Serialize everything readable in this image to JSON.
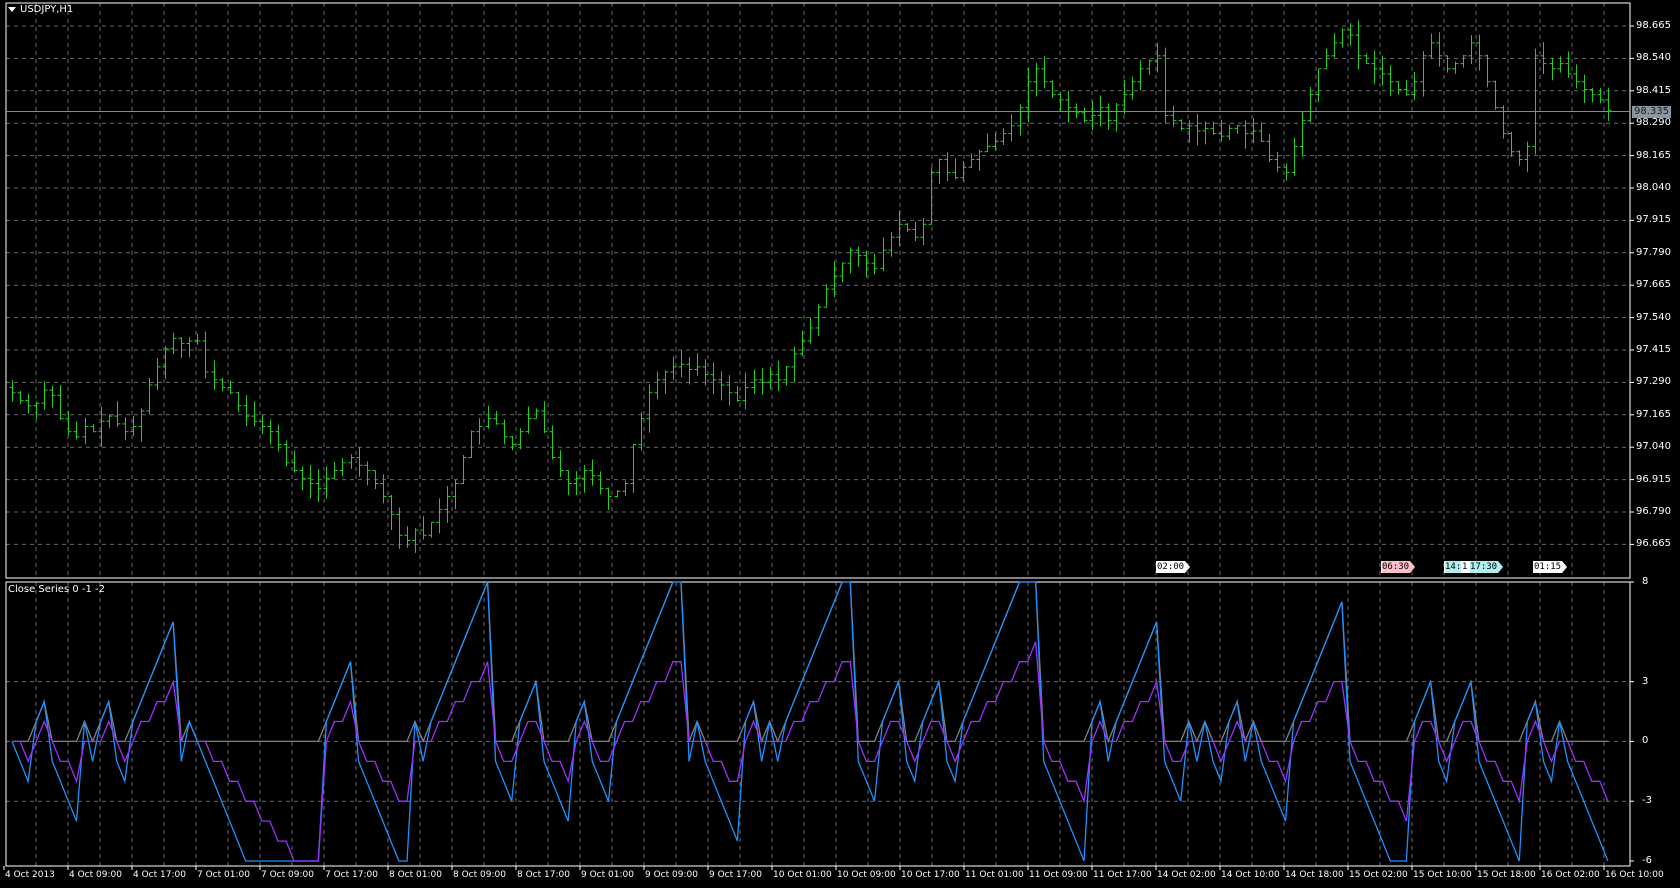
{
  "main": {
    "title": "USDJPY,H1",
    "current_price": "98.335",
    "price_ticks": [
      "98.665",
      "98.540",
      "98.415",
      "98.290",
      "98.165",
      "98.040",
      "97.915",
      "97.790",
      "97.665",
      "97.540",
      "97.415",
      "97.290",
      "97.165",
      "97.040",
      "96.915",
      "96.790",
      "96.665"
    ],
    "markers": [
      {
        "label": "02:00",
        "color": "#ffffff"
      },
      {
        "label": "06:30",
        "color": "#ffc0cb"
      },
      {
        "label": "14:",
        "color": "#b0f0f0"
      },
      {
        "label": "1",
        "color": "#ffffff"
      },
      {
        "label": "17:30",
        "color": "#b0f0f0"
      },
      {
        "label": "01:15",
        "color": "#ffffff"
      }
    ],
    "bar_color": "#22cc22"
  },
  "indicator": {
    "title": "Close Series 0 -1 -2",
    "ticks": [
      "8",
      "3",
      "0",
      "-3",
      "-6"
    ],
    "colors": [
      "#808080",
      "#1e90ff",
      "#9b30ff"
    ]
  },
  "time_axis": [
    "4 Oct 2013",
    "4 Oct 09:00",
    "4 Oct 17:00",
    "7 Oct 01:00",
    "7 Oct 09:00",
    "7 Oct 17:00",
    "8 Oct 01:00",
    "8 Oct 09:00",
    "8 Oct 17:00",
    "9 Oct 01:00",
    "9 Oct 09:00",
    "9 Oct 17:00",
    "10 Oct 01:00",
    "10 Oct 09:00",
    "10 Oct 17:00",
    "11 Oct 01:00",
    "11 Oct 09:00",
    "11 Oct 17:00",
    "14 Oct 02:00",
    "14 Oct 10:00",
    "14 Oct 18:00",
    "15 Oct 02:00",
    "15 Oct 10:00",
    "15 Oct 18:00",
    "16 Oct 02:00",
    "16 Oct 10:00"
  ],
  "chart_data": {
    "type": "line",
    "title": "USDJPY,H1",
    "ylim": [
      96.6,
      98.72
    ],
    "indicator_ylim": [
      -6,
      8
    ],
    "closes": [
      97.25,
      97.22,
      97.2,
      97.21,
      97.26,
      97.24,
      97.15,
      97.1,
      97.08,
      97.12,
      97.1,
      97.14,
      97.16,
      97.13,
      97.1,
      97.12,
      97.18,
      97.28,
      97.35,
      97.42,
      97.46,
      97.44,
      97.45,
      97.45,
      97.33,
      97.3,
      97.27,
      97.25,
      97.2,
      97.16,
      97.14,
      97.12,
      97.1,
      97.05,
      96.98,
      96.95,
      96.92,
      96.9,
      96.88,
      96.92,
      96.95,
      96.98,
      97.0,
      96.97,
      96.95,
      96.9,
      96.85,
      96.78,
      96.7,
      96.68,
      96.72,
      96.7,
      96.75,
      96.8,
      96.85,
      96.9,
      97.0,
      97.1,
      97.12,
      97.15,
      97.13,
      97.08,
      97.05,
      97.1,
      97.15,
      97.18,
      97.1,
      97.0,
      96.95,
      96.9,
      96.92,
      96.95,
      96.93,
      96.88,
      96.85,
      96.87,
      96.9,
      97.05,
      97.15,
      97.25,
      97.3,
      97.33,
      97.35,
      97.36,
      97.34,
      97.35,
      97.32,
      97.3,
      97.28,
      97.25,
      97.22,
      97.27,
      97.3,
      97.29,
      97.32,
      97.3,
      97.35,
      97.4,
      97.45,
      97.5,
      97.58,
      97.65,
      97.7,
      97.75,
      97.8,
      97.78,
      97.75,
      97.73,
      97.8,
      97.85,
      97.9,
      97.88,
      97.85,
      97.9,
      98.1,
      98.15,
      98.1,
      98.08,
      98.12,
      98.15,
      98.18,
      98.2,
      98.22,
      98.25,
      98.28,
      98.35,
      98.45,
      98.5,
      98.45,
      98.4,
      98.38,
      98.35,
      98.33,
      98.3,
      98.32,
      98.35,
      98.3,
      98.36,
      98.4,
      98.45,
      98.5,
      98.53,
      98.55,
      98.32,
      98.3,
      98.27,
      98.28,
      98.26,
      98.27,
      98.25,
      98.24,
      98.27,
      98.28,
      98.25,
      98.26,
      98.22,
      98.15,
      98.12,
      98.1,
      98.2,
      98.3,
      98.4,
      98.5,
      98.55,
      98.6,
      98.65,
      98.63,
      98.55,
      98.52,
      98.5,
      98.48,
      98.45,
      98.42,
      98.4,
      98.45,
      98.55,
      98.6,
      98.55,
      98.5,
      98.52,
      98.55,
      98.6,
      98.55,
      98.45,
      98.35,
      98.25,
      98.18,
      98.15,
      98.2,
      98.55,
      98.52,
      98.5,
      98.52,
      98.48,
      98.45,
      98.42,
      98.4,
      98.38,
      98.34
    ]
  }
}
